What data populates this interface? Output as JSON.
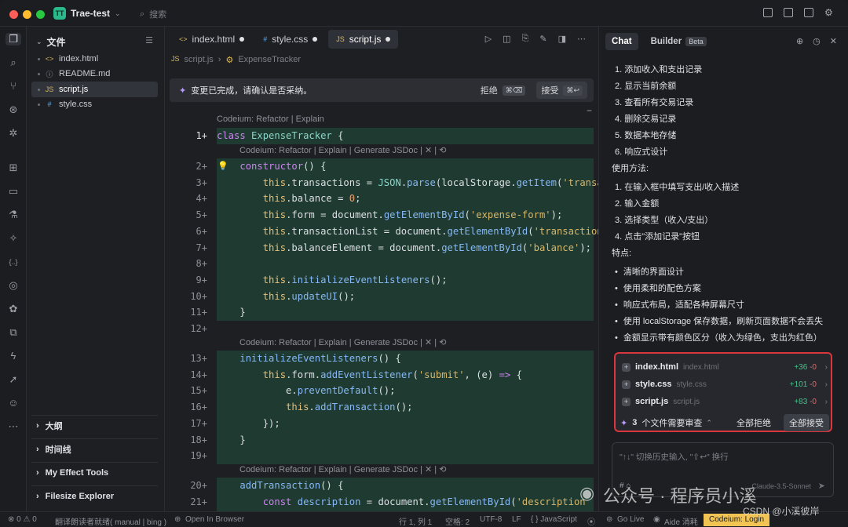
{
  "app": {
    "project_badge": "TT",
    "project_name": "Trae-test",
    "search_placeholder": "搜索"
  },
  "explorer": {
    "title": "文件",
    "files": [
      {
        "name": "index.html",
        "icon": "<>"
      },
      {
        "name": "README.md",
        "icon": "ⓘ"
      },
      {
        "name": "script.js",
        "icon": "JS"
      },
      {
        "name": "style.css",
        "icon": "#"
      }
    ],
    "sections": [
      "大纲",
      "时间线",
      "My Effect Tools",
      "Filesize Explorer"
    ]
  },
  "editor": {
    "tabs": [
      {
        "name": "index.html",
        "icon": "<>"
      },
      {
        "name": "style.css",
        "icon": "#"
      },
      {
        "name": "script.js",
        "icon": "JS"
      }
    ],
    "breadcrumb": [
      "script.js",
      "ExpenseTracker"
    ],
    "breadcrumb_icons": [
      "JS",
      "⚙"
    ],
    "banner": {
      "text": "变更已完成，请确认是否采纳。",
      "reject": "拒绝",
      "reject_key": "⌘⌫",
      "accept": "接受",
      "accept_key": "⌘↩"
    },
    "lens_top": "Codeium: Refactor | Explain",
    "lens_method": "Codeium: Refactor | Explain | Generate JSDoc | ✕ | ⟲",
    "line_numbers": [
      "1+",
      "2+",
      "3+",
      "4+",
      "5+",
      "6+",
      "7+",
      "8+",
      "9+",
      "10+",
      "11+",
      "12+",
      "13+",
      "14+",
      "15+",
      "16+",
      "17+",
      "18+",
      "19+",
      "20+",
      "21+"
    ]
  },
  "chat": {
    "tabs": [
      "Chat",
      "Builder"
    ],
    "beta": "Beta",
    "features": [
      "1. 添加收入和支出记录",
      "2. 显示当前余额",
      "3. 查看所有交易记录",
      "4. 删除交易记录",
      "5. 数据本地存储",
      "6. 响应式设计"
    ],
    "usage_title": "使用方法:",
    "usage": [
      "1. 在输入框中填写支出/收入描述",
      "2. 输入金额",
      "3. 选择类型（收入/支出）",
      "4. 点击\"添加记录\"按钮"
    ],
    "traits_title": "特点:",
    "traits": [
      "清晰的界面设计",
      "使用柔和的配色方案",
      "响应式布局，适配各种屏幕尺寸",
      "使用 localStorage 保存数据，刷新页面数据不会丢失",
      "金额显示带有颜色区分（收入为绿色，支出为红色）"
    ],
    "review": {
      "files": [
        {
          "name": "index.html",
          "path": "index.html",
          "add": "+36",
          "del": "-0"
        },
        {
          "name": "style.css",
          "path": "style.css",
          "add": "+101",
          "del": "-0"
        },
        {
          "name": "script.js",
          "path": "script.js",
          "add": "+83",
          "del": "-0"
        }
      ],
      "count": "3",
      "label": "个文件需要审查",
      "reject_all": "全部拒绝",
      "accept_all": "全部接受"
    },
    "input_placeholder": "\"↑↓\" 切换历史输入, \"⇧↩\" 换行",
    "input_model": "Claude-3.5-Sonnet",
    "input_actions": "#  ⌂"
  },
  "status": {
    "errors": "⊗ 0 ⚠ 0",
    "message": "翻译朗读者就绪( manual | bing )",
    "open_browser": "Open In Browser",
    "position": "行 1, 列 1",
    "spaces": "空格: 2",
    "encoding": "UTF-8",
    "eol": "LF",
    "language": "{ } JavaScript",
    "golive": "Go Live",
    "aide": "Aide 消耗",
    "login": "Codeium: Login"
  },
  "watermark": {
    "main": "公众号 · 程序员小溪",
    "sub": "CSDN @小溪彼岸"
  },
  "colors": {
    "accent": "#29b98b",
    "added_bg": "#1f3b31",
    "review_border": "#d9363e",
    "login_bg": "#f1c453"
  }
}
